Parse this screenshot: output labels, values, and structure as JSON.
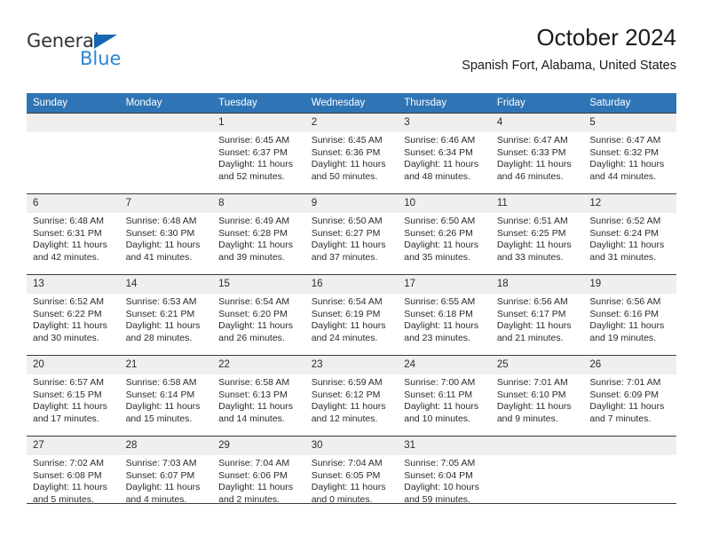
{
  "brand": {
    "name_top": "General",
    "name_bottom": "Blue",
    "triangle_icon": "blue-triangle-logo-icon",
    "color_top": "#333333",
    "color_bottom": "#2b86d1",
    "color_triangle": "#1667b3"
  },
  "header": {
    "title": "October 2024",
    "subtitle": "Spanish Fort, Alabama, United States"
  },
  "colors": {
    "header_bar": "#2f74b5",
    "daynum_band": "#efefef",
    "grid_line": "#3c3c3c",
    "text": "#2b2b2b"
  },
  "weekday_headers": [
    "Sunday",
    "Monday",
    "Tuesday",
    "Wednesday",
    "Thursday",
    "Friday",
    "Saturday"
  ],
  "weeks": [
    [
      {
        "day": "",
        "sunrise": "",
        "sunset": "",
        "daylight": "",
        "empty": true
      },
      {
        "day": "",
        "sunrise": "",
        "sunset": "",
        "daylight": "",
        "empty": true
      },
      {
        "day": "1",
        "sunrise": "Sunrise: 6:45 AM",
        "sunset": "Sunset: 6:37 PM",
        "daylight": "Daylight: 11 hours and 52 minutes."
      },
      {
        "day": "2",
        "sunrise": "Sunrise: 6:45 AM",
        "sunset": "Sunset: 6:36 PM",
        "daylight": "Daylight: 11 hours and 50 minutes."
      },
      {
        "day": "3",
        "sunrise": "Sunrise: 6:46 AM",
        "sunset": "Sunset: 6:34 PM",
        "daylight": "Daylight: 11 hours and 48 minutes."
      },
      {
        "day": "4",
        "sunrise": "Sunrise: 6:47 AM",
        "sunset": "Sunset: 6:33 PM",
        "daylight": "Daylight: 11 hours and 46 minutes."
      },
      {
        "day": "5",
        "sunrise": "Sunrise: 6:47 AM",
        "sunset": "Sunset: 6:32 PM",
        "daylight": "Daylight: 11 hours and 44 minutes."
      }
    ],
    [
      {
        "day": "6",
        "sunrise": "Sunrise: 6:48 AM",
        "sunset": "Sunset: 6:31 PM",
        "daylight": "Daylight: 11 hours and 42 minutes."
      },
      {
        "day": "7",
        "sunrise": "Sunrise: 6:48 AM",
        "sunset": "Sunset: 6:30 PM",
        "daylight": "Daylight: 11 hours and 41 minutes."
      },
      {
        "day": "8",
        "sunrise": "Sunrise: 6:49 AM",
        "sunset": "Sunset: 6:28 PM",
        "daylight": "Daylight: 11 hours and 39 minutes."
      },
      {
        "day": "9",
        "sunrise": "Sunrise: 6:50 AM",
        "sunset": "Sunset: 6:27 PM",
        "daylight": "Daylight: 11 hours and 37 minutes."
      },
      {
        "day": "10",
        "sunrise": "Sunrise: 6:50 AM",
        "sunset": "Sunset: 6:26 PM",
        "daylight": "Daylight: 11 hours and 35 minutes."
      },
      {
        "day": "11",
        "sunrise": "Sunrise: 6:51 AM",
        "sunset": "Sunset: 6:25 PM",
        "daylight": "Daylight: 11 hours and 33 minutes."
      },
      {
        "day": "12",
        "sunrise": "Sunrise: 6:52 AM",
        "sunset": "Sunset: 6:24 PM",
        "daylight": "Daylight: 11 hours and 31 minutes."
      }
    ],
    [
      {
        "day": "13",
        "sunrise": "Sunrise: 6:52 AM",
        "sunset": "Sunset: 6:22 PM",
        "daylight": "Daylight: 11 hours and 30 minutes."
      },
      {
        "day": "14",
        "sunrise": "Sunrise: 6:53 AM",
        "sunset": "Sunset: 6:21 PM",
        "daylight": "Daylight: 11 hours and 28 minutes."
      },
      {
        "day": "15",
        "sunrise": "Sunrise: 6:54 AM",
        "sunset": "Sunset: 6:20 PM",
        "daylight": "Daylight: 11 hours and 26 minutes."
      },
      {
        "day": "16",
        "sunrise": "Sunrise: 6:54 AM",
        "sunset": "Sunset: 6:19 PM",
        "daylight": "Daylight: 11 hours and 24 minutes."
      },
      {
        "day": "17",
        "sunrise": "Sunrise: 6:55 AM",
        "sunset": "Sunset: 6:18 PM",
        "daylight": "Daylight: 11 hours and 23 minutes."
      },
      {
        "day": "18",
        "sunrise": "Sunrise: 6:56 AM",
        "sunset": "Sunset: 6:17 PM",
        "daylight": "Daylight: 11 hours and 21 minutes."
      },
      {
        "day": "19",
        "sunrise": "Sunrise: 6:56 AM",
        "sunset": "Sunset: 6:16 PM",
        "daylight": "Daylight: 11 hours and 19 minutes."
      }
    ],
    [
      {
        "day": "20",
        "sunrise": "Sunrise: 6:57 AM",
        "sunset": "Sunset: 6:15 PM",
        "daylight": "Daylight: 11 hours and 17 minutes."
      },
      {
        "day": "21",
        "sunrise": "Sunrise: 6:58 AM",
        "sunset": "Sunset: 6:14 PM",
        "daylight": "Daylight: 11 hours and 15 minutes."
      },
      {
        "day": "22",
        "sunrise": "Sunrise: 6:58 AM",
        "sunset": "Sunset: 6:13 PM",
        "daylight": "Daylight: 11 hours and 14 minutes."
      },
      {
        "day": "23",
        "sunrise": "Sunrise: 6:59 AM",
        "sunset": "Sunset: 6:12 PM",
        "daylight": "Daylight: 11 hours and 12 minutes."
      },
      {
        "day": "24",
        "sunrise": "Sunrise: 7:00 AM",
        "sunset": "Sunset: 6:11 PM",
        "daylight": "Daylight: 11 hours and 10 minutes."
      },
      {
        "day": "25",
        "sunrise": "Sunrise: 7:01 AM",
        "sunset": "Sunset: 6:10 PM",
        "daylight": "Daylight: 11 hours and 9 minutes."
      },
      {
        "day": "26",
        "sunrise": "Sunrise: 7:01 AM",
        "sunset": "Sunset: 6:09 PM",
        "daylight": "Daylight: 11 hours and 7 minutes."
      }
    ],
    [
      {
        "day": "27",
        "sunrise": "Sunrise: 7:02 AM",
        "sunset": "Sunset: 6:08 PM",
        "daylight": "Daylight: 11 hours and 5 minutes."
      },
      {
        "day": "28",
        "sunrise": "Sunrise: 7:03 AM",
        "sunset": "Sunset: 6:07 PM",
        "daylight": "Daylight: 11 hours and 4 minutes."
      },
      {
        "day": "29",
        "sunrise": "Sunrise: 7:04 AM",
        "sunset": "Sunset: 6:06 PM",
        "daylight": "Daylight: 11 hours and 2 minutes."
      },
      {
        "day": "30",
        "sunrise": "Sunrise: 7:04 AM",
        "sunset": "Sunset: 6:05 PM",
        "daylight": "Daylight: 11 hours and 0 minutes."
      },
      {
        "day": "31",
        "sunrise": "Sunrise: 7:05 AM",
        "sunset": "Sunset: 6:04 PM",
        "daylight": "Daylight: 10 hours and 59 minutes."
      },
      {
        "day": "",
        "sunrise": "",
        "sunset": "",
        "daylight": "",
        "empty": true
      },
      {
        "day": "",
        "sunrise": "",
        "sunset": "",
        "daylight": "",
        "empty": true
      }
    ]
  ]
}
